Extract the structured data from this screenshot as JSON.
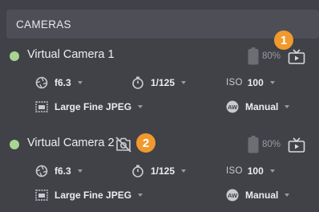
{
  "header": {
    "title": "CAMERAS"
  },
  "cameras": [
    {
      "name": "Virtual Camera 1",
      "status_color": "#a7d690",
      "battery_percent": "80%",
      "battery_level": 0.8,
      "aperture": "f6.3",
      "shutter": "1/125",
      "iso_label": "ISO",
      "iso": "100",
      "quality": "Large Fine JPEG",
      "mode": "Manual",
      "callout": "1",
      "disabled_icon": false
    },
    {
      "name": "Virtual Camera 2",
      "status_color": "#a7d690",
      "battery_percent": "80%",
      "battery_level": 0.8,
      "aperture": "f6.3",
      "shutter": "1/125",
      "iso_label": "ISO",
      "iso": "100",
      "quality": "Large Fine JPEG",
      "mode": "Manual",
      "callout": "2",
      "disabled_icon": true
    }
  ],
  "icons": {
    "aperture": "aperture-icon",
    "shutter": "shutter-timer-icon",
    "quality": "image-quality-icon",
    "mode": "exposure-mode-icon",
    "battery": "battery-icon",
    "liveview": "live-view-icon",
    "camera_off": "camera-off-icon"
  },
  "colors": {
    "accent_orange": "#f09a2d",
    "status_green": "#a7d690"
  }
}
